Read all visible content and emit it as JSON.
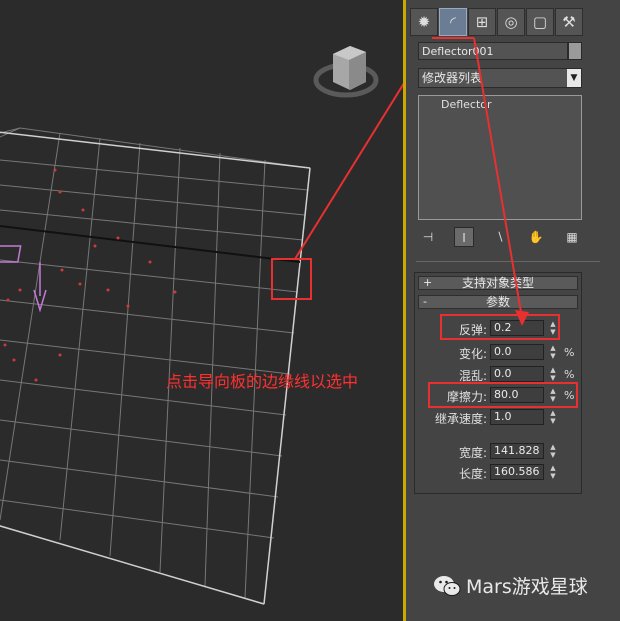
{
  "panel": {
    "tabs": [
      {
        "icon": "create-icon"
      },
      {
        "icon": "modify-icon"
      },
      {
        "icon": "hierarchy-icon"
      },
      {
        "icon": "motion-icon"
      },
      {
        "icon": "display-icon"
      },
      {
        "icon": "utilities-icon"
      }
    ],
    "object_name": "Deflector001",
    "modifier_list": "修改器列表",
    "stack_item": "Deflector",
    "rollouts": {
      "supported": {
        "sign": "+",
        "title": "支持对象类型"
      },
      "params": {
        "sign": "-",
        "title": "参数"
      }
    },
    "params": {
      "bounce": {
        "label": "反弹:",
        "value": "0.2"
      },
      "variation": {
        "label": "变化:",
        "value": "0.0",
        "unit": "%"
      },
      "chaos": {
        "label": "混乱:",
        "value": "0.0",
        "unit": "%"
      },
      "friction": {
        "label": "摩擦力:",
        "value": "80.0",
        "unit": "%"
      },
      "inherit": {
        "label": "继承速度:",
        "value": "1.0"
      },
      "width": {
        "label": "宽度:",
        "value": "141.828"
      },
      "length": {
        "label": "长度:",
        "value": "160.586"
      }
    }
  },
  "annotation": {
    "text": "点击导向板的边缘线以选中",
    "color": "#ff3030"
  },
  "watermark": {
    "text": "Mars游戏星球"
  },
  "colors": {
    "viewport_bg": "#2b2b2b",
    "active_viewport_border": "#c9a800",
    "panel_bg": "#444444",
    "highlight": "#e83030"
  }
}
